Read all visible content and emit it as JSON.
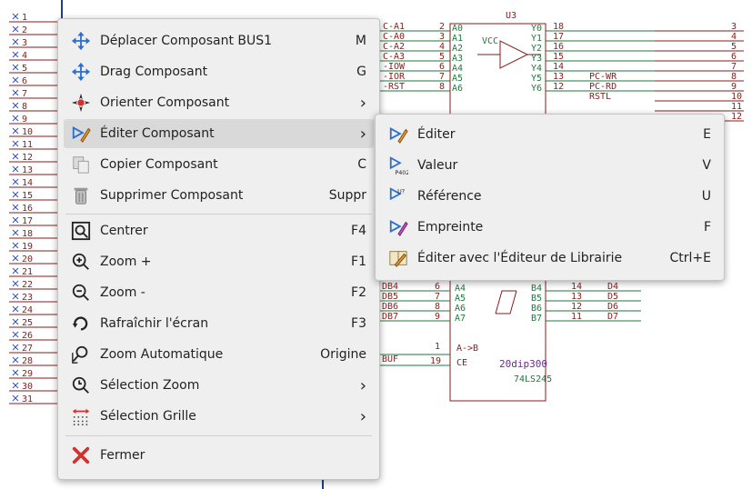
{
  "schematic": {
    "chip_label": "U3",
    "chip_part": "74LS245",
    "chip_footprint": "20dip300",
    "left_pins": [
      "1",
      "2",
      "3",
      "4",
      "5",
      "6",
      "7",
      "8",
      "9",
      "10",
      "11",
      "12",
      "13",
      "14",
      "15",
      "16",
      "17",
      "18",
      "19",
      "20",
      "21",
      "22",
      "23",
      "24",
      "25",
      "26",
      "27",
      "28",
      "29",
      "30",
      "31"
    ],
    "right_pins": [
      "3",
      "4",
      "5",
      "6",
      "7",
      "8",
      "9",
      "10",
      "11",
      "12"
    ],
    "top_nets": [
      "C-A1",
      "C-A0",
      "C-A2",
      "C-A3",
      "-IOW",
      "-IOR",
      "-RST"
    ],
    "top_pin_nums": [
      "2",
      "3",
      "4",
      "5",
      "6",
      "7",
      "8"
    ],
    "chip_inputs": [
      "A0",
      "A1",
      "A2",
      "A3",
      "A4",
      "A5",
      "A6"
    ],
    "chip_outputs": [
      "Y0",
      "Y1",
      "Y2",
      "Y3",
      "Y4",
      "Y5",
      "Y6"
    ],
    "out_pin_nums": [
      "18",
      "17",
      "16",
      "15",
      "14",
      "13",
      "12"
    ],
    "out_nets": [
      "PC-WR",
      "PC-RD",
      "RSTL"
    ],
    "low_nets": [
      "DB4",
      "DB5",
      "DB6",
      "DB7"
    ],
    "low_pin_nums": [
      "6",
      "7",
      "8",
      "9"
    ],
    "low_in": [
      "A4",
      "A5",
      "A6",
      "A7"
    ],
    "low_out": [
      "B4",
      "B5",
      "B6",
      "B7"
    ],
    "low_out_pins": [
      "14",
      "13",
      "12",
      "11"
    ],
    "low_out_nets": [
      "D4",
      "D5",
      "D6",
      "D7"
    ],
    "dir_label": "A->B",
    "ce_label": "CE",
    "buf_label": "BUF",
    "pin1": "1",
    "pin19": "19",
    "vcc": "VCC"
  },
  "main_menu": {
    "items": [
      {
        "label": "Déplacer Composant BUS1",
        "shortcut": "M",
        "icon": "move-icon"
      },
      {
        "label": "Drag Composant",
        "shortcut": "G",
        "icon": "drag-icon"
      },
      {
        "label": "Orienter Composant",
        "shortcut": "›",
        "icon": "orient-icon"
      },
      {
        "label": "Éditer Composant",
        "shortcut": "›",
        "icon": "edit-component-icon"
      },
      {
        "label": "Copier Composant",
        "shortcut": "C",
        "icon": "copy-icon"
      },
      {
        "label": "Supprimer Composant",
        "shortcut": "Suppr",
        "icon": "delete-icon"
      },
      {
        "label": "Centrer",
        "shortcut": "F4",
        "icon": "center-icon"
      },
      {
        "label": "Zoom +",
        "shortcut": "F1",
        "icon": "zoom-in-icon"
      },
      {
        "label": "Zoom -",
        "shortcut": "F2",
        "icon": "zoom-out-icon"
      },
      {
        "label": "Rafraîchir l'écran",
        "shortcut": "F3",
        "icon": "refresh-icon"
      },
      {
        "label": "Zoom Automatique",
        "shortcut": "Origine",
        "icon": "zoom-auto-icon"
      },
      {
        "label": "Sélection Zoom",
        "shortcut": "›",
        "icon": "zoom-select-icon"
      },
      {
        "label": "Sélection Grille",
        "shortcut": "›",
        "icon": "grid-icon"
      },
      {
        "label": "Fermer",
        "shortcut": "",
        "icon": "close-icon"
      }
    ]
  },
  "sub_menu": {
    "items": [
      {
        "label": "Éditer",
        "shortcut": "E",
        "icon": "edit-icon"
      },
      {
        "label": "Valeur",
        "shortcut": "V",
        "icon": "value-icon"
      },
      {
        "label": "Référence",
        "shortcut": "U",
        "icon": "reference-icon"
      },
      {
        "label": "Empreinte",
        "shortcut": "F",
        "icon": "footprint-icon"
      },
      {
        "label": "Éditer avec l'Éditeur de Librairie",
        "shortcut": "Ctrl+E",
        "icon": "library-editor-icon"
      }
    ]
  },
  "colors": {
    "wire": "#1b7a3a",
    "component": "#8b1a1a",
    "menu_bg": "#efefef",
    "highlight": "#d9d9d9",
    "accent_blue": "#2a6fd0",
    "close_red": "#d2322d"
  }
}
